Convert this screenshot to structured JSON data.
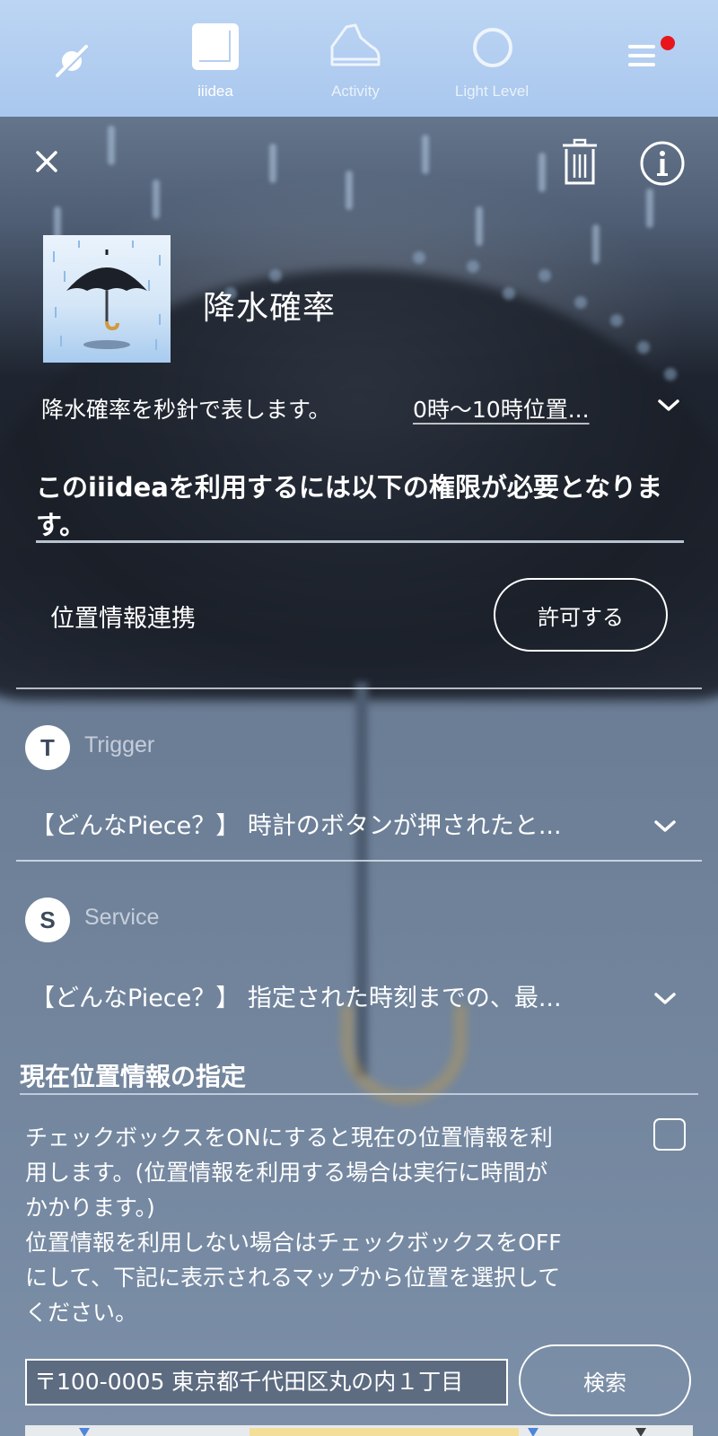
{
  "tabs": [
    {
      "label": "",
      "icon": "no-watch-icon"
    },
    {
      "label": "iiidea",
      "icon": "iiidea-square-icon"
    },
    {
      "label": "Activity",
      "icon": "shoe-icon"
    },
    {
      "label": "Light Level",
      "icon": "circle-icon"
    },
    {
      "label": "",
      "icon": "menu-icon"
    }
  ],
  "header": {
    "close_icon": "close-icon",
    "trash_icon": "trash-icon",
    "info_icon": "info-icon"
  },
  "iiidea": {
    "title": "降水確率",
    "thumbnail_icon": "umbrella-rain-icon",
    "description_part1": "降水確率を秒針で表します。",
    "description_part2": "0時〜10時位置..."
  },
  "permissions": {
    "title": "このiiideaを利用するには以下の権限が必要となります。",
    "item_label": "位置情報連携",
    "allow_button": "許可する"
  },
  "trigger": {
    "badge": "T",
    "label": "Trigger",
    "piece_text": "【どんなPiece？】 時計のボタンが押されたと..."
  },
  "service": {
    "badge": "S",
    "label": "Service",
    "piece_text": "【どんなPiece？】 指定された時刻までの、最..."
  },
  "location": {
    "title": "現在位置情報の指定",
    "description_lines": [
      "チェックボックスをONにすると現在の位置情報を利",
      "用します。(位置情報を利用する場合は実行に時間が",
      "かかります。)",
      "位置情報を利用しない場合はチェックボックスをOFF",
      "にして、下記に表示されるマップから位置を選択して",
      "ください。"
    ],
    "checkbox_checked": false,
    "address_value": "〒100-0005 東京都千代田区丸の内１丁目",
    "search_button": "検索"
  },
  "colors": {
    "topbar": "#b3cef1",
    "notification_dot": "#e8161b",
    "badge_text": "#3d4a5c"
  }
}
